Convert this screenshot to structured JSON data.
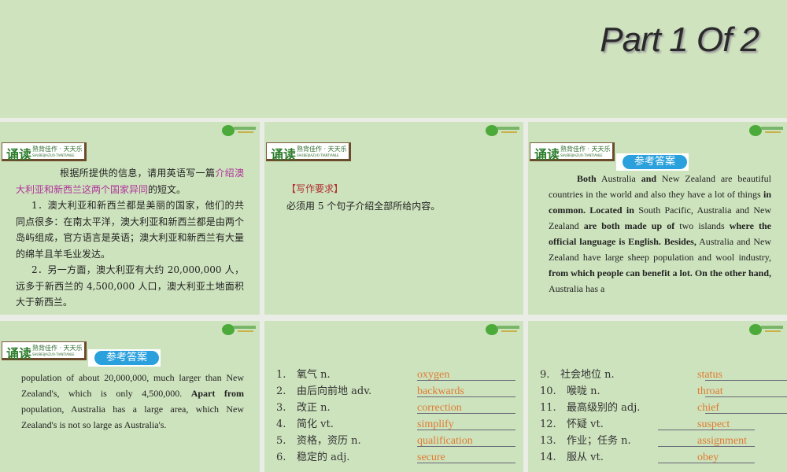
{
  "title": "Part 1 Of 2",
  "badge": {
    "big": "诵读",
    "small": "熟背佳作 · 天天乐",
    "pinyin": "SHUBEIJIAZUO·TIANTIANLE"
  },
  "answer_label": "参考答案",
  "panel1": {
    "p1_a": "根据所提供的信息，请用英语写一篇",
    "p1_pink": "介绍澳大利亚和新西兰这两个国家异同",
    "p1_b": "的短文。",
    "p2": "1．澳大利亚和新西兰都是美丽的国家，他们的共同点很多：在南太平洋，澳大利亚和新西兰都是由两个岛屿组成，官方语言是英语；澳大利亚和新西兰有大量的绵羊且羊毛业发达。",
    "p3": "2．另一方面，澳大利亚有大约 20,000,000 人，远多于新西兰的 4,500,000 人口，澳大利亚土地面积大于新西兰。"
  },
  "panel2": {
    "heading": "【写作要求】",
    "text": "必须用 5 个句子介绍全部所给内容。"
  },
  "panel3": {
    "segments": [
      {
        "t": "Both",
        "b": true
      },
      {
        "t": " Australia ",
        "b": false
      },
      {
        "t": "and",
        "b": true
      },
      {
        "t": " New Zealand are beautiful countries in the world and also they have a lot of things ",
        "b": false
      },
      {
        "t": "in common. Located in",
        "b": true
      },
      {
        "t": " South Pacific, Australia and New Zealand ",
        "b": false
      },
      {
        "t": "are both made up of",
        "b": true
      },
      {
        "t": " two islands ",
        "b": false
      },
      {
        "t": "where the official language is English. Besides,",
        "b": true
      },
      {
        "t": " Australia and New Zealand have large sheep population and wool industry, ",
        "b": false
      },
      {
        "t": "from which people can benefit a lot. On the other hand,",
        "b": true
      },
      {
        "t": " Australia has a",
        "b": false
      }
    ]
  },
  "panel4": {
    "segments": [
      {
        "t": "population of about 20,000,000, much larger than New Zealand's, which is only 4,500,000. ",
        "b": false
      },
      {
        "t": "Apart from",
        "b": true
      },
      {
        "t": " population, Australia has a large area, which New Zealand's is not so large as Australia's.",
        "b": false
      }
    ]
  },
  "vocab_left": [
    {
      "n": "1.",
      "cn": "氧气  n.",
      "en": "oxygen"
    },
    {
      "n": "2.",
      "cn": "由后向前地  adv.",
      "en": "backwards"
    },
    {
      "n": "3.",
      "cn": "改正  n.",
      "en": "correction"
    },
    {
      "n": "4.",
      "cn": "简化  vt.",
      "en": "simplify"
    },
    {
      "n": "5.",
      "cn": "资格，资历  n.",
      "en": "qualification"
    },
    {
      "n": "6.",
      "cn": "稳定的  adj.",
      "en": "secure"
    }
  ],
  "vocab_right": [
    {
      "n": "9.",
      "cn": "社会地位  n.",
      "en": "status"
    },
    {
      "n": "10.",
      "cn": "喉咙  n.",
      "en": "throat"
    },
    {
      "n": "11.",
      "cn": "最高级别的  adj.",
      "en": "chief"
    },
    {
      "n": "12.",
      "cn": "怀疑  vt.",
      "en": "suspect"
    },
    {
      "n": "13.",
      "cn": "作业；任务  n.",
      "en": "assignment"
    },
    {
      "n": "14.",
      "cn": "服从  vt.",
      "en": "obey"
    }
  ]
}
